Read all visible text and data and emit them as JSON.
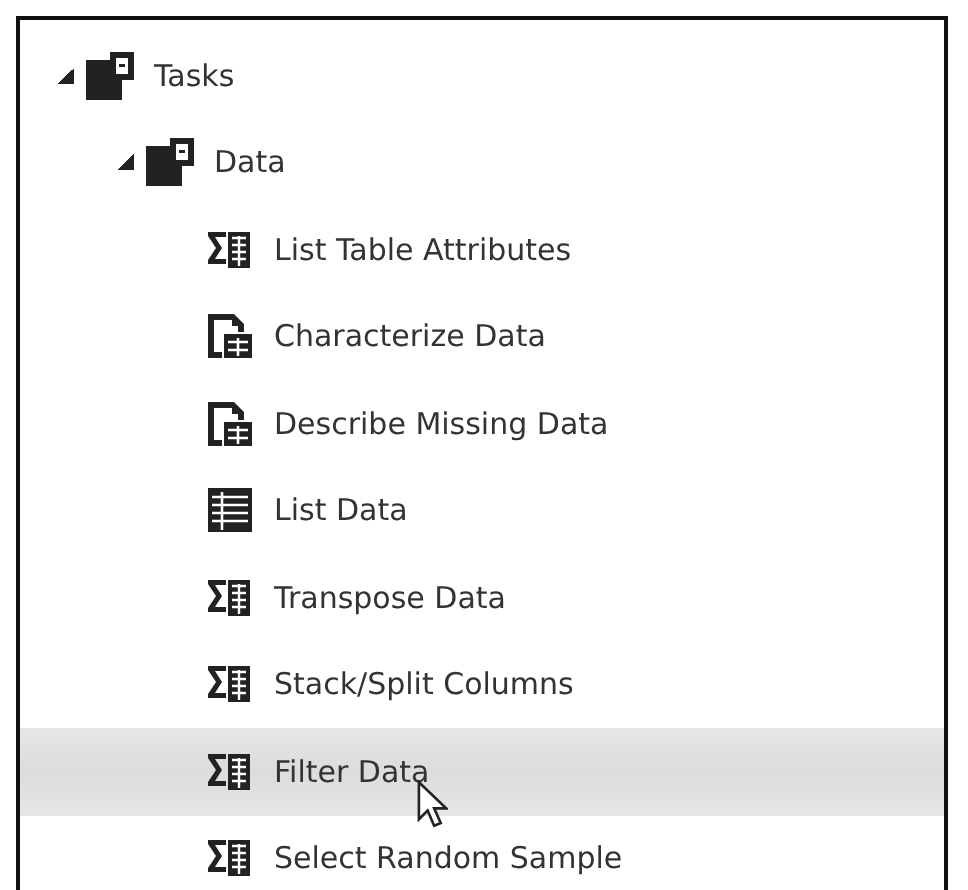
{
  "tree": [
    {
      "label": "Tasks",
      "kind": "folder",
      "expanded": true,
      "hovered": false,
      "children": [
        {
          "label": "Data",
          "kind": "folder",
          "expanded": true,
          "hovered": false,
          "children": [
            {
              "label": "List Table Attributes",
              "kind": "sigma",
              "hovered": false
            },
            {
              "label": "Characterize Data",
              "kind": "report",
              "hovered": false
            },
            {
              "label": "Describe Missing Data",
              "kind": "report",
              "hovered": false
            },
            {
              "label": "List Data",
              "kind": "table",
              "hovered": false
            },
            {
              "label": "Transpose Data",
              "kind": "sigma",
              "hovered": false
            },
            {
              "label": "Stack/Split Columns",
              "kind": "sigma",
              "hovered": false
            },
            {
              "label": "Filter Data",
              "kind": "sigma",
              "hovered": true
            },
            {
              "label": "Select Random Sample",
              "kind": "sigma",
              "hovered": false
            }
          ]
        }
      ]
    }
  ]
}
